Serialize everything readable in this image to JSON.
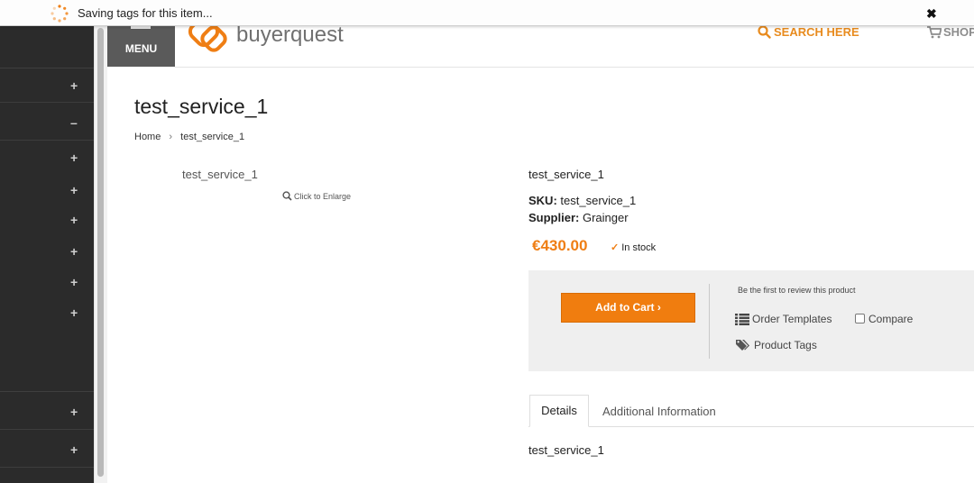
{
  "notification": {
    "text": "Saving tags for this item...",
    "close_symbol": "✖"
  },
  "sidebar": {
    "items": [
      {
        "symbol": "+"
      },
      {
        "symbol": "–"
      },
      {
        "symbol": "+"
      },
      {
        "symbol": "+"
      },
      {
        "symbol": "+"
      },
      {
        "symbol": "+"
      },
      {
        "symbol": "+"
      },
      {
        "symbol": "+"
      },
      {
        "symbol": "+"
      },
      {
        "symbol": "+"
      }
    ]
  },
  "header": {
    "menu_label": "MENU",
    "logo_text": "buyerquest",
    "search_label": "SEARCH HERE",
    "shop_label": "SHOP",
    "accent_color": "#ef7e14"
  },
  "product": {
    "title": "test_service_1",
    "breadcrumb": {
      "home": "Home",
      "separator": "›",
      "current": "test_service_1"
    },
    "image_alt": "test_service_1",
    "enlarge_label": "Click to Enlarge",
    "name": "test_service_1",
    "sku_label": "SKU:",
    "sku_value": "test_service_1",
    "supplier_label": "Supplier:",
    "supplier_value": "Grainger",
    "price": "€430.00",
    "stock_check": "✓",
    "stock": "In stock"
  },
  "actions": {
    "add_to_cart": "Add to Cart ›",
    "review": "Be the first to review this product",
    "order_templates": "Order Templates",
    "compare": "Compare",
    "product_tags": "Product Tags"
  },
  "tabs": [
    {
      "label": "Details",
      "active": true
    },
    {
      "label": "Additional Information",
      "active": false
    }
  ],
  "tab_content": "test_service_1"
}
